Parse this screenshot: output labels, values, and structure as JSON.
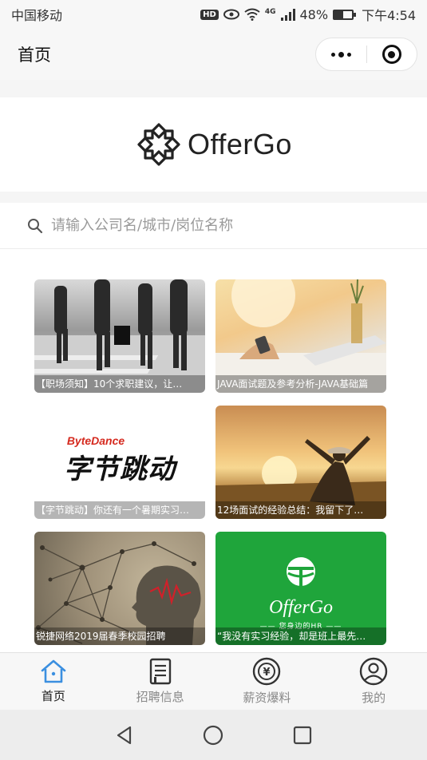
{
  "status_bar": {
    "carrier": "中国移动",
    "hd_badge": "HD",
    "network": "4G",
    "battery_percent": "48%",
    "battery_level": 0.48,
    "time": "下午4:54"
  },
  "nav": {
    "title": "首页"
  },
  "brand": {
    "logo_text": "OfferGo"
  },
  "search": {
    "placeholder": "请输入公司名/城市/岗位名称"
  },
  "cards": [
    {
      "caption": "【职场须知】10个求职建议，让…"
    },
    {
      "caption": "JAVA面试题及参考分析-JAVA基础篇"
    },
    {
      "caption": "【字节跳动】你还有一个暑期实习…",
      "logo_en": "ByteDance",
      "logo_cn": "字节跳动"
    },
    {
      "caption": "12场面试的经验总结：我留下了…"
    },
    {
      "caption": "锐捷网络2019届春季校园招聘"
    },
    {
      "caption": "“我没有实习经验，却是班上最先…",
      "logo_text": "OfferGo",
      "logo_sub": "—— 您身边的HR ——"
    }
  ],
  "tab_bar": {
    "tabs": [
      {
        "label": "首页",
        "icon": "home-icon",
        "active": true
      },
      {
        "label": "招聘信息",
        "icon": "document-icon",
        "active": false
      },
      {
        "label": "薪资爆料",
        "icon": "money-icon",
        "active": false
      },
      {
        "label": "我的",
        "icon": "user-icon",
        "active": false
      }
    ]
  },
  "colors": {
    "active_tab_icon": "#3b8fe0",
    "inactive_tab": "#888888",
    "card_green": "#1fa53b",
    "bytedance_red": "#d52a1f"
  }
}
